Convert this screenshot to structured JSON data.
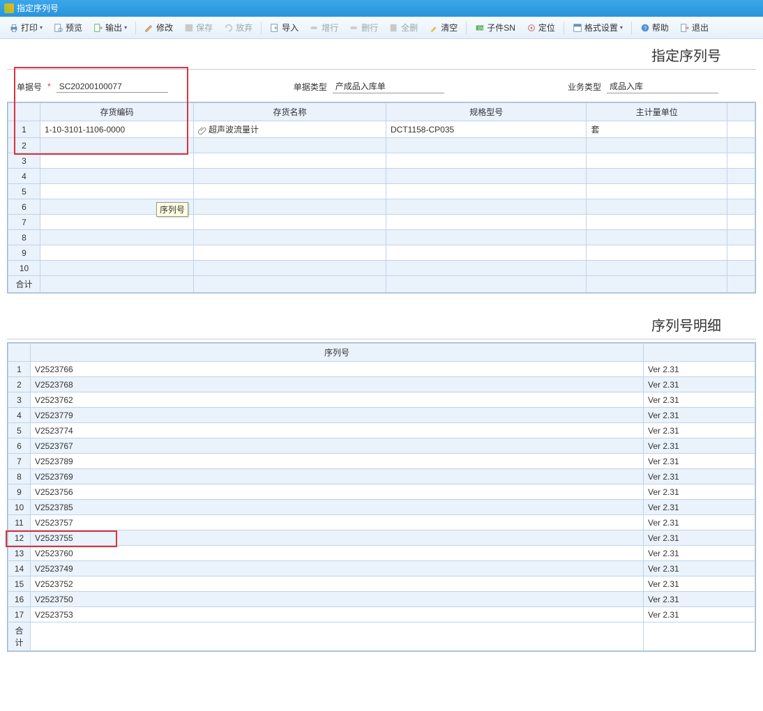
{
  "window": {
    "title": "指定序列号"
  },
  "toolbar": {
    "print": "打印",
    "preview": "预览",
    "export": "输出",
    "modify": "修改",
    "save": "保存",
    "discard": "放弃",
    "import": "导入",
    "addRow": "增行",
    "delRow": "删行",
    "delAll": "全删",
    "clear": "清空",
    "childSN": "子件SN",
    "locate": "定位",
    "format": "格式设置",
    "help": "帮助",
    "exit": "退出"
  },
  "header": {
    "pageTitle": "指定序列号",
    "docNoLabel": "单据号",
    "docNo": "SC20200100077",
    "docTypeLabel": "单据类型",
    "docType": "产成品入库单",
    "bizTypeLabel": "业务类型",
    "bizType": "成品入库"
  },
  "topGrid": {
    "cols": {
      "code": "存货编码",
      "name": "存货名称",
      "spec": "规格型号",
      "unit": "主计量单位"
    },
    "rows": [
      {
        "code": "1-10-3101-1106-0000",
        "name": "超声波流量计",
        "spec": "DCT1158-CP035",
        "unit": "套"
      },
      {},
      {},
      {},
      {},
      {},
      {},
      {},
      {},
      {}
    ],
    "sumLabel": "合计",
    "tooltip": "序列号"
  },
  "detail": {
    "title": "序列号明细",
    "colSerial": "序列号",
    "colVer": "",
    "rows": [
      {
        "sn": "V2523766",
        "ver": "Ver 2.31"
      },
      {
        "sn": "V2523768",
        "ver": "Ver 2.31"
      },
      {
        "sn": "V2523762",
        "ver": "Ver 2.31"
      },
      {
        "sn": "V2523779",
        "ver": "Ver 2.31"
      },
      {
        "sn": "V2523774",
        "ver": "Ver 2.31"
      },
      {
        "sn": "V2523767",
        "ver": "Ver 2.31"
      },
      {
        "sn": "V2523789",
        "ver": "Ver 2.31"
      },
      {
        "sn": "V2523769",
        "ver": "Ver 2.31"
      },
      {
        "sn": "V2523756",
        "ver": "Ver 2.31"
      },
      {
        "sn": "V2523785",
        "ver": "Ver 2.31"
      },
      {
        "sn": "V2523757",
        "ver": "Ver 2.31"
      },
      {
        "sn": "V2523755",
        "ver": "Ver 2.31"
      },
      {
        "sn": "V2523760",
        "ver": "Ver 2.31"
      },
      {
        "sn": "V2523749",
        "ver": "Ver 2.31"
      },
      {
        "sn": "V2523752",
        "ver": "Ver 2.31"
      },
      {
        "sn": "V2523750",
        "ver": "Ver 2.31"
      },
      {
        "sn": "V2523753",
        "ver": "Ver 2.31"
      }
    ],
    "sumLabel": "合计"
  }
}
